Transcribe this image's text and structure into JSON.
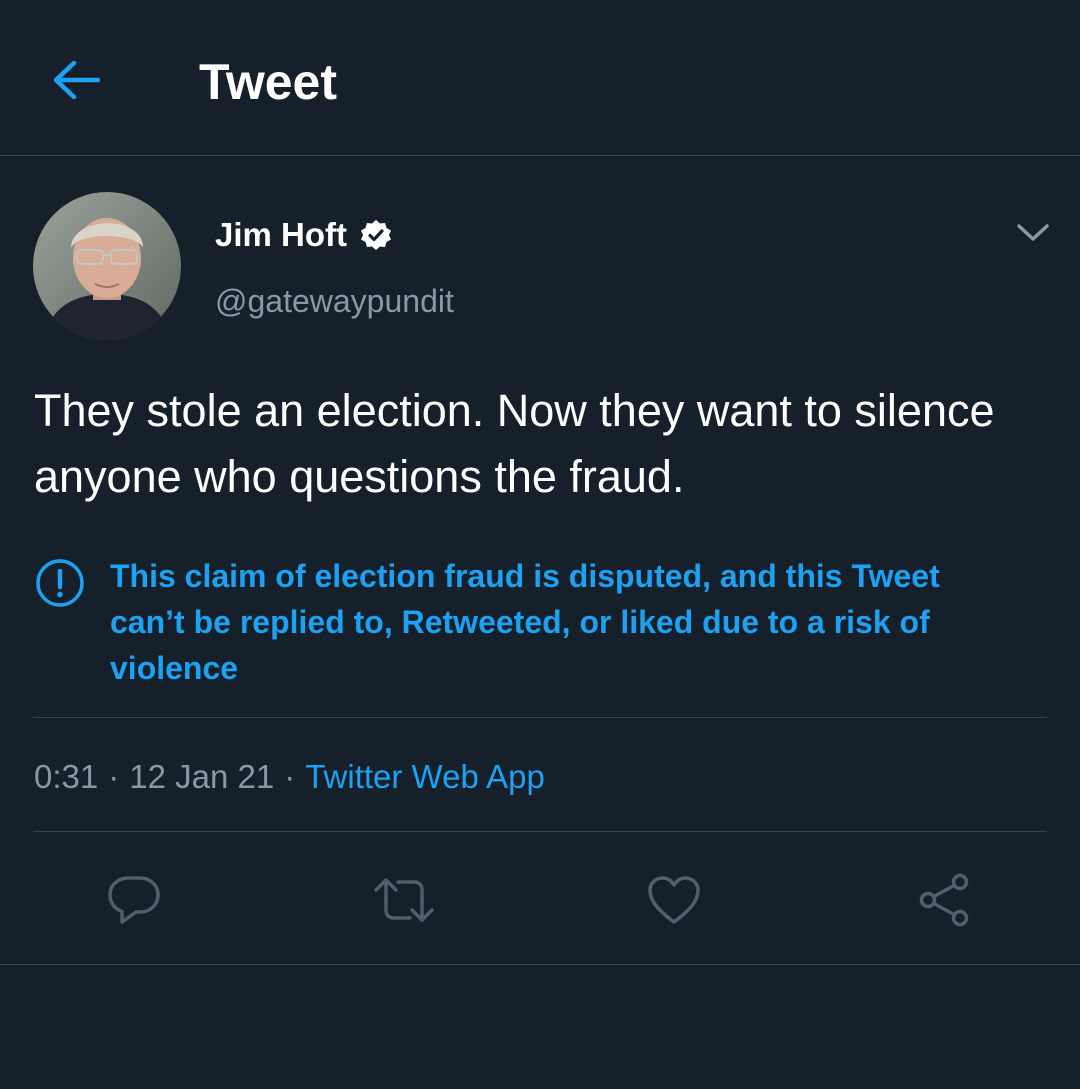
{
  "header": {
    "title": "Tweet",
    "back_icon": "arrow-left-icon"
  },
  "tweet": {
    "author": {
      "display_name": "Jim Hoft",
      "handle": "@gatewaypundit",
      "verified_icon": "verified-badge-icon"
    },
    "text": "They stole an election. Now they want to silence anyone who questions the fraud.",
    "notice": {
      "icon": "exclamation-circle-icon",
      "text": "This claim of election fraud is disputed, and this Tweet can’t be replied to, Retweeted, or liked due to a risk of violence"
    },
    "meta": {
      "time": "0:31",
      "date": "12 Jan 21",
      "separator": "·",
      "source": "Twitter Web App"
    },
    "actions": {
      "reply_icon": "reply-icon",
      "retweet_icon": "retweet-icon",
      "like_icon": "heart-icon",
      "share_icon": "share-icon"
    }
  },
  "colors": {
    "background": "#15202b",
    "accent": "#1da1f2",
    "secondary_text": "#8899a6",
    "divider": "#38444d",
    "icon_muted": "#8899a6"
  }
}
